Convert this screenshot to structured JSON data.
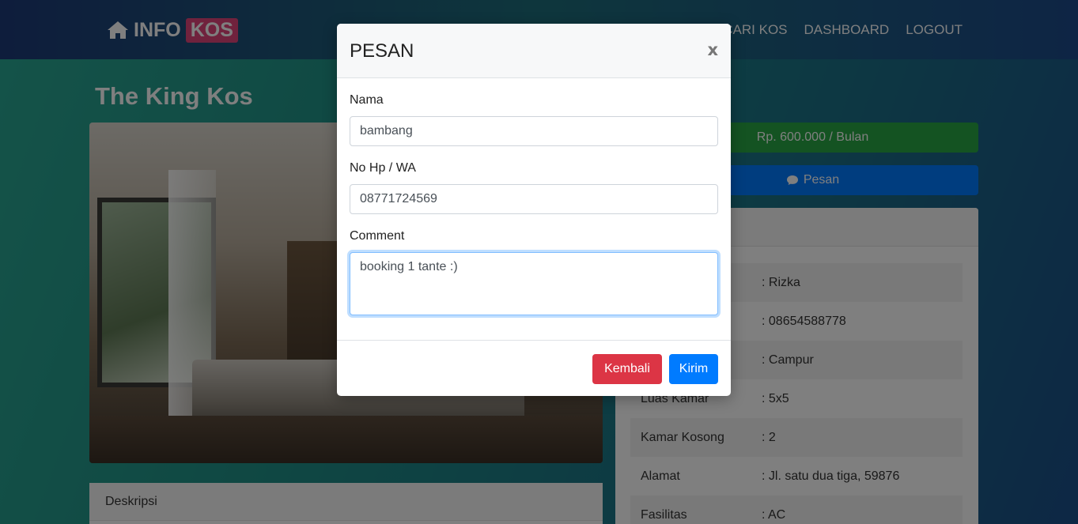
{
  "navbar": {
    "brand_left": "INFO",
    "brand_right": "KOS",
    "links": [
      "CARI KOS",
      "DASHBOARD",
      "LOGOUT"
    ]
  },
  "page": {
    "title": "The King Kos",
    "price_label": "Rp. 600.000 / Bulan",
    "pesan_label": "Pesan",
    "description_header": "Deskripsi"
  },
  "info_table": [
    {
      "key": "",
      "value": ": Rizka"
    },
    {
      "key": "",
      "value": ": 08654588778"
    },
    {
      "key": "",
      "value": ": Campur"
    },
    {
      "key": "Luas Kamar",
      "value": ": 5x5"
    },
    {
      "key": "Kamar Kosong",
      "value": ": 2"
    },
    {
      "key": "Alamat",
      "value": ": Jl. satu dua tiga, 59876"
    },
    {
      "key": "Fasilitas",
      "value": ": AC"
    }
  ],
  "modal": {
    "title": "PESAN",
    "close_label": "x",
    "fields": {
      "nama_label": "Nama",
      "nama_value": "bambang",
      "hp_label": "No Hp / WA",
      "hp_value": "08771724569",
      "comment_label": "Comment",
      "comment_value": "booking 1 tante :)"
    },
    "buttons": {
      "kembali": "Kembali",
      "kirim": "Kirim"
    }
  },
  "colors": {
    "price_green": "#28a745",
    "primary_blue": "#007bff",
    "danger_red": "#dc3545",
    "brand_pink": "#e0457b"
  }
}
